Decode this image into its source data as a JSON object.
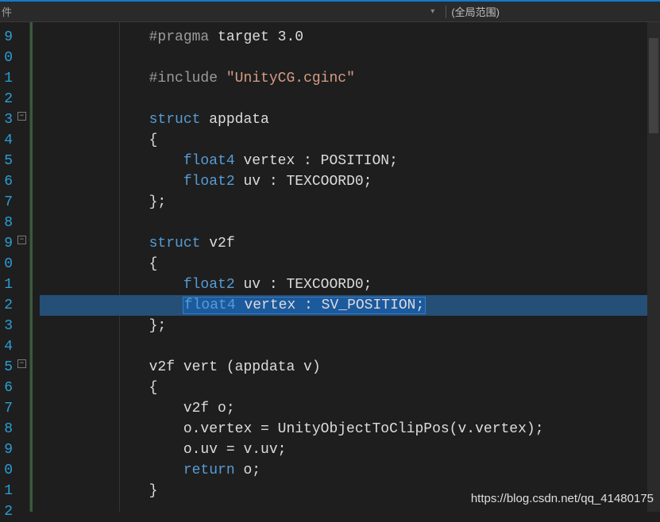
{
  "toolbar": {
    "file_label": "件",
    "scope_label": "(全局范围)"
  },
  "line_numbers": [
    "9",
    "0",
    "1",
    "2",
    "3",
    "4",
    "5",
    "6",
    "7",
    "8",
    "9",
    "0",
    "1",
    "2",
    "3",
    "4",
    "5",
    "6",
    "7",
    "8",
    "9",
    "0",
    "1",
    "2"
  ],
  "code": {
    "l0": {
      "prag": "#pragma",
      "rest": " target 3.0"
    },
    "l1": "",
    "l2": {
      "prag": "#include",
      "str": " \"UnityCG.cginc\""
    },
    "l3": "",
    "l4": {
      "kw": "struct",
      "name": " appdata"
    },
    "l5": "{",
    "l6": {
      "type": "float4",
      "rest": " vertex : POSITION;"
    },
    "l7": {
      "type": "float2",
      "rest": " uv : TEXCOORD0;"
    },
    "l8": "};",
    "l9": "",
    "l10": {
      "kw": "struct",
      "name": " v2f"
    },
    "l11": "{",
    "l12": {
      "type": "float2",
      "rest": " uv : TEXCOORD0;"
    },
    "l13": {
      "type": "float4",
      "rest": " vertex : SV_POSITION;"
    },
    "l14": "};",
    "l15": "",
    "l16": "v2f vert (appdata v)",
    "l17": "{",
    "l18": "v2f o;",
    "l19": "o.vertex = UnityObjectToClipPos(v.vertex);",
    "l20": "o.uv = v.uv;",
    "l21": {
      "kw": "return",
      "rest": " o;"
    },
    "l22": "}",
    "l23": ""
  },
  "watermark": "https://blog.csdn.net/qq_41480175"
}
